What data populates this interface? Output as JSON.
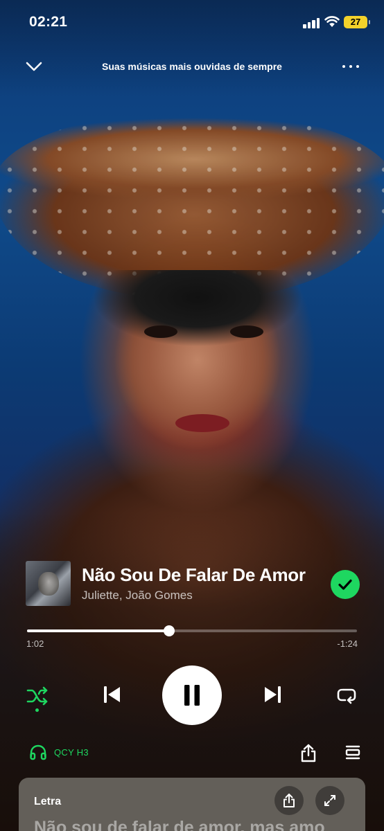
{
  "status_bar": {
    "time": "02:21",
    "battery": "27"
  },
  "header": {
    "title": "Suas músicas mais ouvidas de sempre"
  },
  "track": {
    "title": "Não Sou De Falar De Amor",
    "artists": "Juliette, João Gomes"
  },
  "progress": {
    "elapsed": "1:02",
    "remaining": "-1:24",
    "fraction": 0.43
  },
  "device": {
    "name": "QCY H3"
  },
  "lyrics": {
    "label": "Letra",
    "line": "Não sou de falar de amor, mas amo"
  },
  "colors": {
    "accent": "#1ed760",
    "battery": "#f3d22b"
  },
  "icons": {
    "header_left": "chevron-down-icon",
    "header_right": "more-icon",
    "liked": "check-icon",
    "shuffle": "shuffle-icon",
    "previous": "skip-previous-icon",
    "play_pause": "pause-icon",
    "next": "skip-next-icon",
    "repeat": "repeat-icon",
    "device": "headphones-icon",
    "share": "share-icon",
    "queue": "queue-icon",
    "expand": "expand-icon"
  }
}
